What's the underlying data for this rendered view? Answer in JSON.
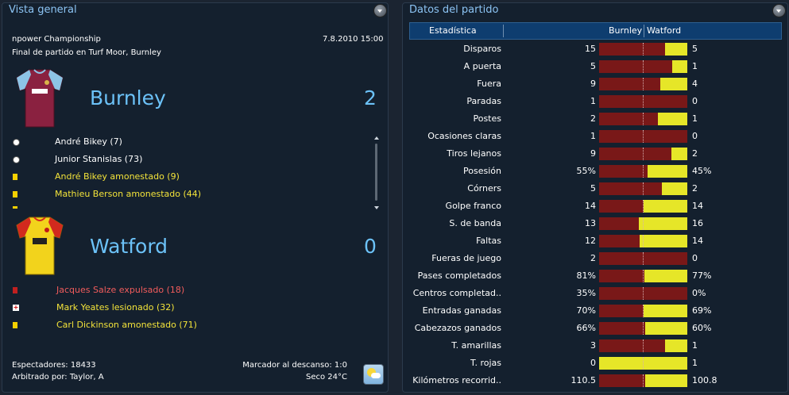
{
  "overview": {
    "title": "Vista general",
    "competition": "npower Championship",
    "datetime": "7.8.2010 15:00",
    "venue": "Final de partido en Turf Moor, Burnley",
    "home": {
      "name": "Burnley",
      "score": "2",
      "events": [
        {
          "icon": "ball",
          "text": "André Bikey (7)",
          "color": "#ffffff"
        },
        {
          "icon": "ball",
          "text": "Junior Stanislas (73)",
          "color": "#ffffff"
        },
        {
          "icon": "yellow-card",
          "text": "André Bikey amonestado (9)",
          "color": "#f3e33a"
        },
        {
          "icon": "yellow-card",
          "text": "Mathieu Berson amonestado (44)",
          "color": "#f3e33a"
        }
      ]
    },
    "away": {
      "name": "Watford",
      "score": "0",
      "events": [
        {
          "icon": "red-card",
          "text": "Jacques Salze expulsado (18)",
          "color": "#f25c5c"
        },
        {
          "icon": "injury",
          "text": "Mark Yeates lesionado (32)",
          "color": "#f3e33a"
        },
        {
          "icon": "yellow-card",
          "text": "Carl Dickinson amonestado (71)",
          "color": "#f3e33a"
        }
      ]
    },
    "attendance": "Espectadores: 18433",
    "referee": "Arbitrado por: Taylor, A",
    "halftime": "Marcador al descanso: 1:0",
    "weather": "Seco 24°C",
    "colors": {
      "accent": "#6cc2f8",
      "yellow": "#f3e33a",
      "red": "#f25c5c"
    }
  },
  "stats": {
    "title": "Datos del partido",
    "header": {
      "stat": "Estadística",
      "home": "Burnley",
      "away": "Watford"
    },
    "colors": {
      "home_bar": "#791818",
      "away_bar": "#e6e628"
    },
    "rows": [
      {
        "label": "Disparos",
        "home": "15",
        "away": "5",
        "away_share": 0.25
      },
      {
        "label": "A puerta",
        "home": "5",
        "away": "1",
        "away_share": 0.167
      },
      {
        "label": "Fuera",
        "home": "9",
        "away": "4",
        "away_share": 0.308
      },
      {
        "label": "Paradas",
        "home": "1",
        "away": "0",
        "away_share": 0
      },
      {
        "label": "Postes",
        "home": "2",
        "away": "1",
        "away_share": 0.333
      },
      {
        "label": "Ocasiones claras",
        "home": "1",
        "away": "0",
        "away_share": 0
      },
      {
        "label": "Tiros lejanos",
        "home": "9",
        "away": "2",
        "away_share": 0.182
      },
      {
        "label": "Posesión",
        "home": "55%",
        "away": "45%",
        "away_share": 0.45
      },
      {
        "label": "Córners",
        "home": "5",
        "away": "2",
        "away_share": 0.286
      },
      {
        "label": "Golpe franco",
        "home": "14",
        "away": "14",
        "away_share": 0.5
      },
      {
        "label": "S. de banda",
        "home": "13",
        "away": "16",
        "away_share": 0.552
      },
      {
        "label": "Faltas",
        "home": "12",
        "away": "14",
        "away_share": 0.538
      },
      {
        "label": "Fueras de juego",
        "home": "2",
        "away": "0",
        "away_share": 0
      },
      {
        "label": "Pases completados",
        "home": "81%",
        "away": "77%",
        "away_share": 0.487
      },
      {
        "label": "Centros completad..",
        "home": "35%",
        "away": "0%",
        "away_share": 0
      },
      {
        "label": "Entradas ganadas",
        "home": "70%",
        "away": "69%",
        "away_share": 0.496
      },
      {
        "label": "Cabezazos ganados",
        "home": "66%",
        "away": "60%",
        "away_share": 0.476
      },
      {
        "label": "T. amarillas",
        "home": "3",
        "away": "1",
        "away_share": 0.25
      },
      {
        "label": "T. rojas",
        "home": "0",
        "away": "1",
        "away_share": 1
      },
      {
        "label": "Kilómetros recorrid..",
        "home": "110.5",
        "away": "100.8",
        "away_share": 0.477
      }
    ]
  }
}
